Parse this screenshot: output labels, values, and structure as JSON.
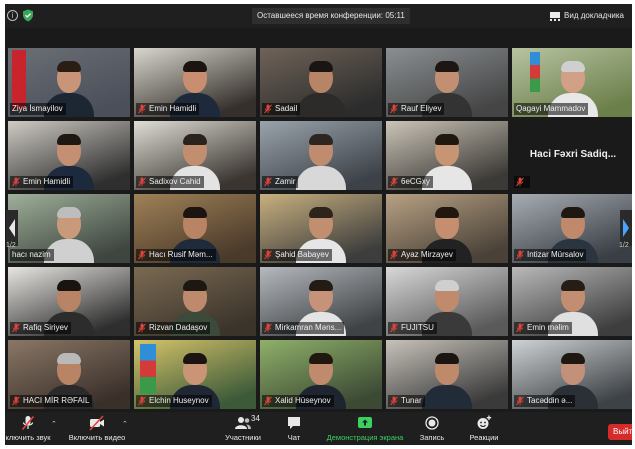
{
  "header": {
    "timer_text": "Оставшееся время конференции: 05:11",
    "view_label": "Вид докладчика"
  },
  "participants": [
    {
      "name": "Ziya İsmayilov",
      "muted": false
    },
    {
      "name": "Emin Hamidli",
      "muted": true
    },
    {
      "name": "Sadail",
      "muted": true
    },
    {
      "name": "Rauf Eliyev",
      "muted": true
    },
    {
      "name": "Qagayi Mammadov",
      "muted": false,
      "active": true
    },
    {
      "name": "Emin Hamidli",
      "muted": true
    },
    {
      "name": "Sadixov Cahid",
      "muted": true
    },
    {
      "name": "Zamir",
      "muted": true
    },
    {
      "name": "6eCGxy",
      "muted": true
    },
    {
      "name": "",
      "muted": true,
      "no_video_name": "Haci Fəxri Sadiq..."
    },
    {
      "name": "hacı nazim",
      "muted": false
    },
    {
      "name": "Hacı Rusif Məm...",
      "muted": true
    },
    {
      "name": "Şahid Babayev",
      "muted": true
    },
    {
      "name": "Ayaz Mirzayev",
      "muted": true
    },
    {
      "name": "Intizar Mürsalov",
      "muted": true
    },
    {
      "name": "Rafiq Siriyev",
      "muted": true
    },
    {
      "name": "Rizvan Dadaşov",
      "muted": true
    },
    {
      "name": "Mirkamran Məns...",
      "muted": true
    },
    {
      "name": "FUJITSU",
      "muted": true
    },
    {
      "name": "Emin məlim",
      "muted": true
    },
    {
      "name": "HACI MİR RƏFAIL",
      "muted": true
    },
    {
      "name": "Elchin Huseynov",
      "muted": true
    },
    {
      "name": "Xalid Hüseynov",
      "muted": true
    },
    {
      "name": "Tunar",
      "muted": true
    },
    {
      "name": "Tacəddin ə...",
      "muted": true
    }
  ],
  "pagination": {
    "left_label": "1/2",
    "right_label": "1/2"
  },
  "toolbar": {
    "unmute_label": "ключить звук",
    "video_label": "Включить видео",
    "participants_label": "Участники",
    "participants_count": "34",
    "chat_label": "Чат",
    "share_label": "Демонстрация экрана",
    "record_label": "Запись",
    "reactions_label": "Реакции",
    "leave_label": "Выйти"
  },
  "colors": {
    "share_green": "#3ad15f",
    "leave_red": "#d52b2b",
    "active_border": "#e6d94a",
    "mute_red": "#e0433a"
  }
}
